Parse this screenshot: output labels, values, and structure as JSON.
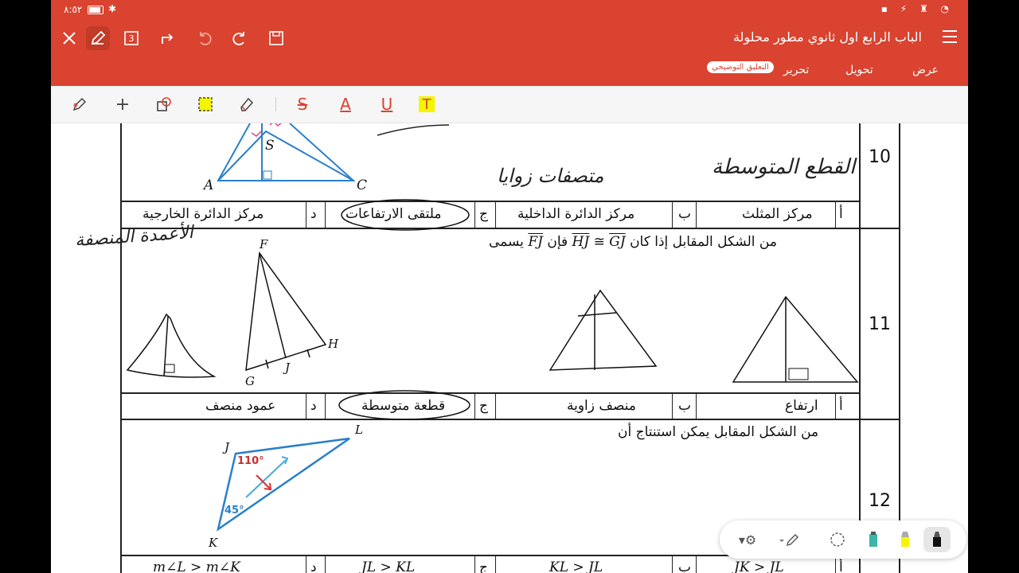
{
  "status_bar": {
    "time": "٨:٥٢"
  },
  "header": {
    "doc_title": "الباب الرابع اول ثانوي مطور محلولة",
    "tabs": [
      {
        "label": "عرض"
      },
      {
        "label": "تحويل"
      },
      {
        "label": "تحرير"
      },
      {
        "label": "التعليق التوضيحي"
      }
    ],
    "page_count_badge": "3"
  },
  "document": {
    "q10": {
      "number": "10",
      "handwriting_1": "القطع المتوسطة",
      "handwriting_2": "متصفات زوايا",
      "options": [
        {
          "letter": "أ",
          "text": "مركز المثلث"
        },
        {
          "letter": "ب",
          "text": "مركز الدائرة الداخلية"
        },
        {
          "letter": "ج",
          "text": "ملتقى الارتفاعات"
        },
        {
          "letter": "د",
          "text": "مركز الدائرة الخارجية"
        }
      ],
      "figure_labels": [
        "S",
        "A",
        "C"
      ]
    },
    "q11": {
      "number": "11",
      "stem_prefix": "من الشكل المقابل إذا كان",
      "seg_hj": "HJ",
      "seg_gj": "GJ",
      "cong": "≅",
      "then": "فإن",
      "seg_fj": "FJ",
      "called": "يسمى",
      "margin_note": "الأعمدة المنصفة",
      "options": [
        {
          "letter": "أ",
          "text": "ارتفاع"
        },
        {
          "letter": "ب",
          "text": "منصف زاوية"
        },
        {
          "letter": "ج",
          "text": "قطعة متوسطة"
        },
        {
          "letter": "د",
          "text": "عمود منصف"
        }
      ],
      "figure_labels": [
        "F",
        "G",
        "J",
        "H"
      ]
    },
    "q12": {
      "number": "12",
      "stem": "من الشكل المقابل يمكن استنتاج أن",
      "figure_labels": [
        "J",
        "L",
        "K"
      ],
      "angle_j": "110°",
      "angle_k": "45°",
      "options": [
        {
          "letter": "أ",
          "text": "JK > JL"
        },
        {
          "letter": "ب",
          "text": "KL > JL"
        },
        {
          "letter": "ج",
          "text": "JL > KL"
        },
        {
          "letter": "د",
          "text": "m∠L > m∠K"
        }
      ]
    }
  },
  "colors": {
    "accent": "#d9432f",
    "highlight": "#f5f500"
  },
  "icons": [
    "close-icon",
    "pen-icon",
    "pages-icon",
    "share-icon",
    "undo-icon",
    "redo-icon",
    "save-icon",
    "menu-icon",
    "lasso-icon",
    "plus-icon",
    "shape-icon",
    "area-select-icon",
    "eraser-icon",
    "strike-icon",
    "text-color-icon",
    "underline-icon",
    "highlight-text-icon",
    "settings-icon",
    "pencil-icon",
    "circle-select-icon",
    "marker-teal-icon",
    "marker-yellow-icon",
    "marker-black-icon"
  ]
}
